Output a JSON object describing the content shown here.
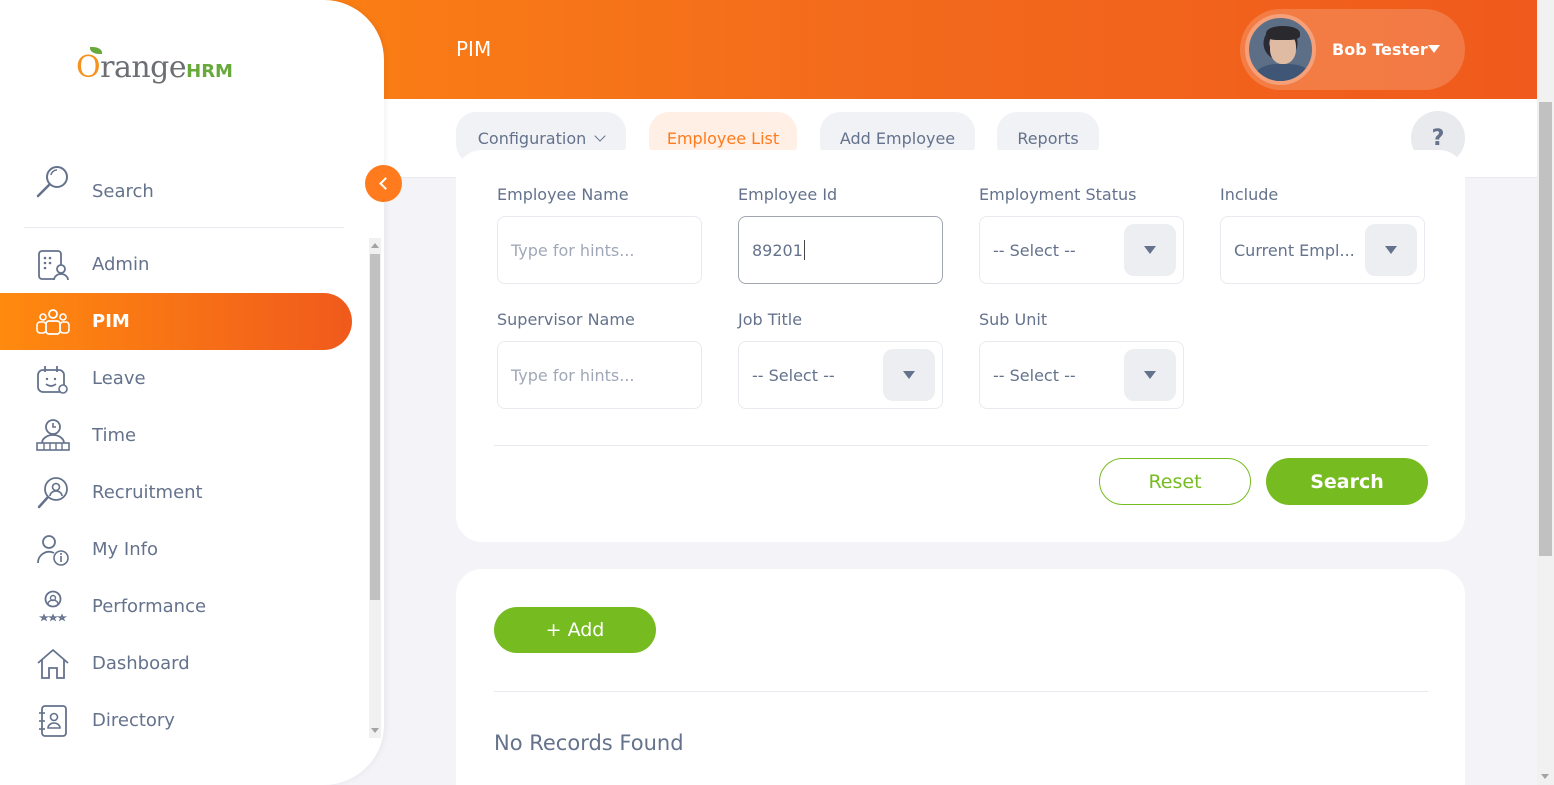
{
  "header": {
    "page_title": "PIM",
    "user_name": "Bob Tester",
    "brand_color": "#ff7b1d"
  },
  "logo": {
    "o": "O",
    "text": "range",
    "hrm": "HRM"
  },
  "subnav": {
    "configuration": "Configuration",
    "employee_list": "Employee List",
    "add_employee": "Add Employee",
    "reports": "Reports",
    "help": "?"
  },
  "sidebar": {
    "search_label": "Search",
    "items": [
      {
        "label": "Admin",
        "icon": "admin-icon"
      },
      {
        "label": "PIM",
        "icon": "pim-icon",
        "active": true
      },
      {
        "label": "Leave",
        "icon": "leave-icon"
      },
      {
        "label": "Time",
        "icon": "time-icon"
      },
      {
        "label": "Recruitment",
        "icon": "recruitment-icon"
      },
      {
        "label": "My Info",
        "icon": "my-info-icon"
      },
      {
        "label": "Performance",
        "icon": "performance-icon"
      },
      {
        "label": "Dashboard",
        "icon": "dashboard-icon"
      },
      {
        "label": "Directory",
        "icon": "directory-icon"
      }
    ]
  },
  "filters": {
    "employee_name": {
      "label": "Employee Name",
      "placeholder": "Type for hints..."
    },
    "employee_id": {
      "label": "Employee Id",
      "value": "89201"
    },
    "employment_status": {
      "label": "Employment Status",
      "value": "-- Select --"
    },
    "include": {
      "label": "Include",
      "value": "Current Empl..."
    },
    "supervisor_name": {
      "label": "Supervisor Name",
      "placeholder": "Type for hints..."
    },
    "job_title": {
      "label": "Job Title",
      "value": "-- Select --"
    },
    "sub_unit": {
      "label": "Sub Unit",
      "value": "-- Select --"
    },
    "reset_label": "Reset",
    "search_label": "Search"
  },
  "results": {
    "add_label": "+  Add",
    "empty_message": "No Records Found"
  },
  "colors": {
    "accent_green": "#76bc21",
    "text": "#64728c"
  }
}
